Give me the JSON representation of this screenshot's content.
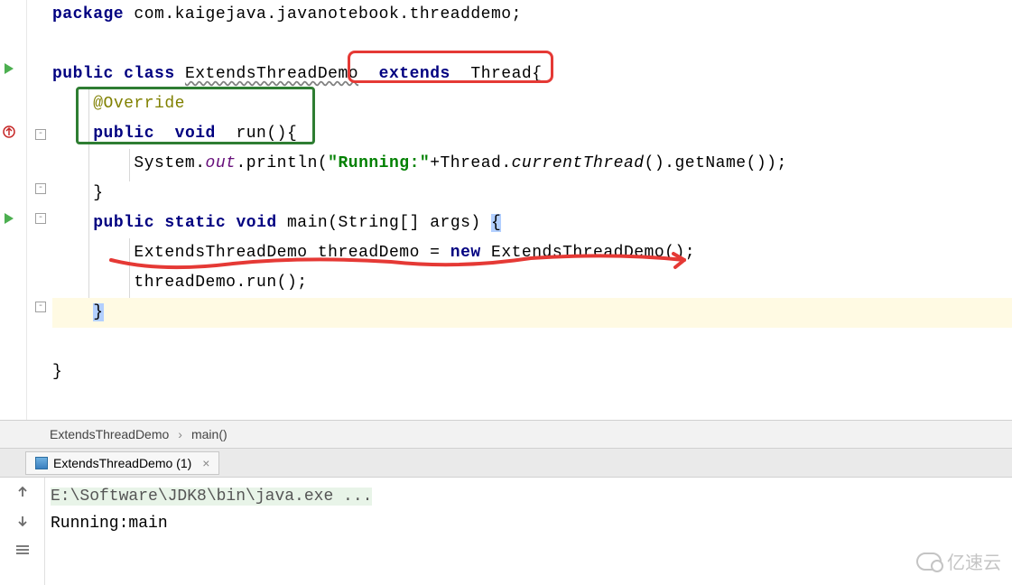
{
  "code": {
    "package_line": {
      "kw": "package ",
      "path": "com.kaigejava.javanotebook.threaddemo;"
    },
    "class_decl": {
      "public": "public ",
      "class": "class ",
      "name": "ExtendsThreadDemo",
      "extends": "  extends  ",
      "super": "Thread{"
    },
    "override": "@Override",
    "run_decl": {
      "public": "public  ",
      "void": "void  ",
      "sig": "run(){"
    },
    "println": {
      "prefix": "System.",
      "out": "out",
      "dot": ".println(",
      "str": "\"Running:\"",
      "plus": "+Thread.",
      "ct": "currentThread",
      "suffix": "().getName());"
    },
    "close_run": "}",
    "main_decl": {
      "public": "public ",
      "static": "static ",
      "void": "void ",
      "sig": "main(String[] args) ",
      "brace": "{"
    },
    "new_line": {
      "type": "ExtendsThreadDemo ",
      "var": "threadDemo = ",
      "new": "new ",
      "ctor": "ExtendsThreadDemo();"
    },
    "call_line": "threadDemo.run();",
    "close_main": "}",
    "close_class": "}"
  },
  "breadcrumbs": {
    "class": "ExtendsThreadDemo",
    "method": "main()"
  },
  "run_tab": {
    "label": "ExtendsThreadDemo (1)"
  },
  "console": {
    "cmd": "E:\\Software\\JDK8\\bin\\java.exe ...",
    "out1": "Running:main"
  },
  "watermark": "亿速云"
}
